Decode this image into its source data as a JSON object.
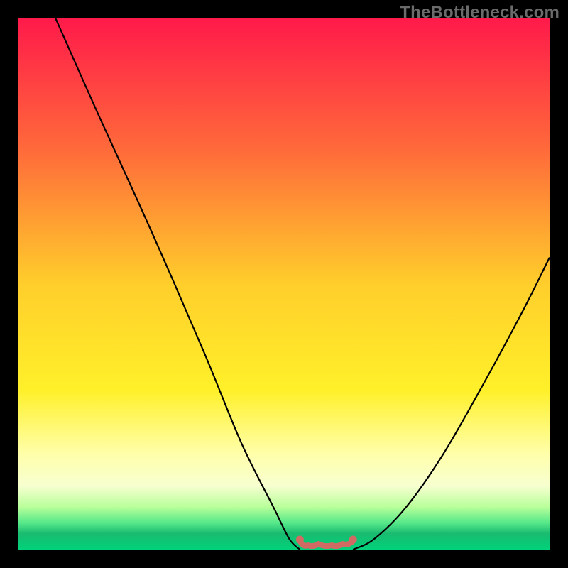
{
  "watermark": "TheBottleneck.com",
  "chart_data": {
    "type": "line",
    "title": "",
    "xlabel": "",
    "ylabel": "",
    "xlim": [
      0,
      100
    ],
    "ylim": [
      0,
      100
    ],
    "curve_left": {
      "name": "curve-descending",
      "x": [
        7,
        15,
        25,
        35,
        42,
        48,
        51,
        53
      ],
      "y": [
        100,
        82,
        60,
        37,
        20,
        8,
        2,
        0
      ]
    },
    "curve_right": {
      "name": "curve-ascending",
      "x": [
        63,
        67,
        73,
        80,
        88,
        95,
        100
      ],
      "y": [
        0,
        2,
        8,
        18,
        32,
        45,
        55
      ]
    },
    "flat_segment": {
      "name": "flat-bottom-marker",
      "color": "#d16a63",
      "points_x": [
        53,
        54.5,
        56.5,
        59,
        61,
        63
      ],
      "points_y": [
        0.5,
        0,
        0,
        0,
        0,
        0.5
      ]
    },
    "gradient_stops": [
      {
        "offset": 0.0,
        "color": "#ff1a4a"
      },
      {
        "offset": 0.25,
        "color": "#ff6b3a"
      },
      {
        "offset": 0.5,
        "color": "#ffce2b"
      },
      {
        "offset": 0.7,
        "color": "#fff02a"
      },
      {
        "offset": 0.82,
        "color": "#ffffaa"
      },
      {
        "offset": 0.88,
        "color": "#f7ffd0"
      },
      {
        "offset": 0.92,
        "color": "#b8ff9a"
      },
      {
        "offset": 0.95,
        "color": "#55e88a"
      },
      {
        "offset": 0.97,
        "color": "#1abb70"
      },
      {
        "offset": 1.0,
        "color": "#00d17a"
      }
    ]
  }
}
